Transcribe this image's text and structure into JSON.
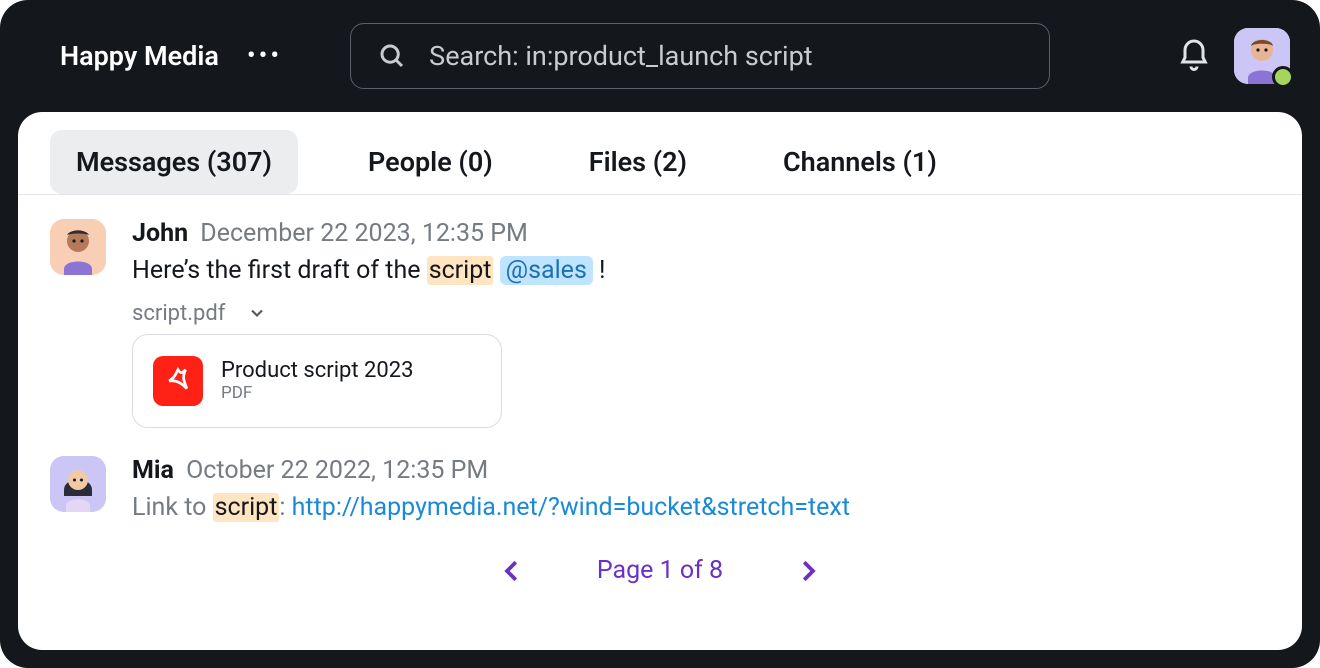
{
  "topbar": {
    "workspace": "Happy Media",
    "search_text": "Search: in:product_launch script"
  },
  "tabs": {
    "messages": "Messages (307)",
    "people": "People (0)",
    "files": "Files (2)",
    "channels": "Channels (1)"
  },
  "results": [
    {
      "user": "John",
      "time": "December 22 2023, 12:35 PM",
      "segments": {
        "pre": "Here’s the first draft of the ",
        "hl": "script",
        "mention": "@sales",
        "post": " !"
      },
      "file_label": "script.pdf",
      "attachment": {
        "title": "Product script 2023",
        "type": "PDF"
      }
    },
    {
      "user": "Mia",
      "time": "October 22 2022, 12:35 PM",
      "segments": {
        "pre": "Link to ",
        "hl": "script",
        "mid": ": ",
        "link": "http://happymedia.net/?wind=bucket&stretch=text"
      }
    }
  ],
  "pager": {
    "label": "Page 1 of 8"
  }
}
